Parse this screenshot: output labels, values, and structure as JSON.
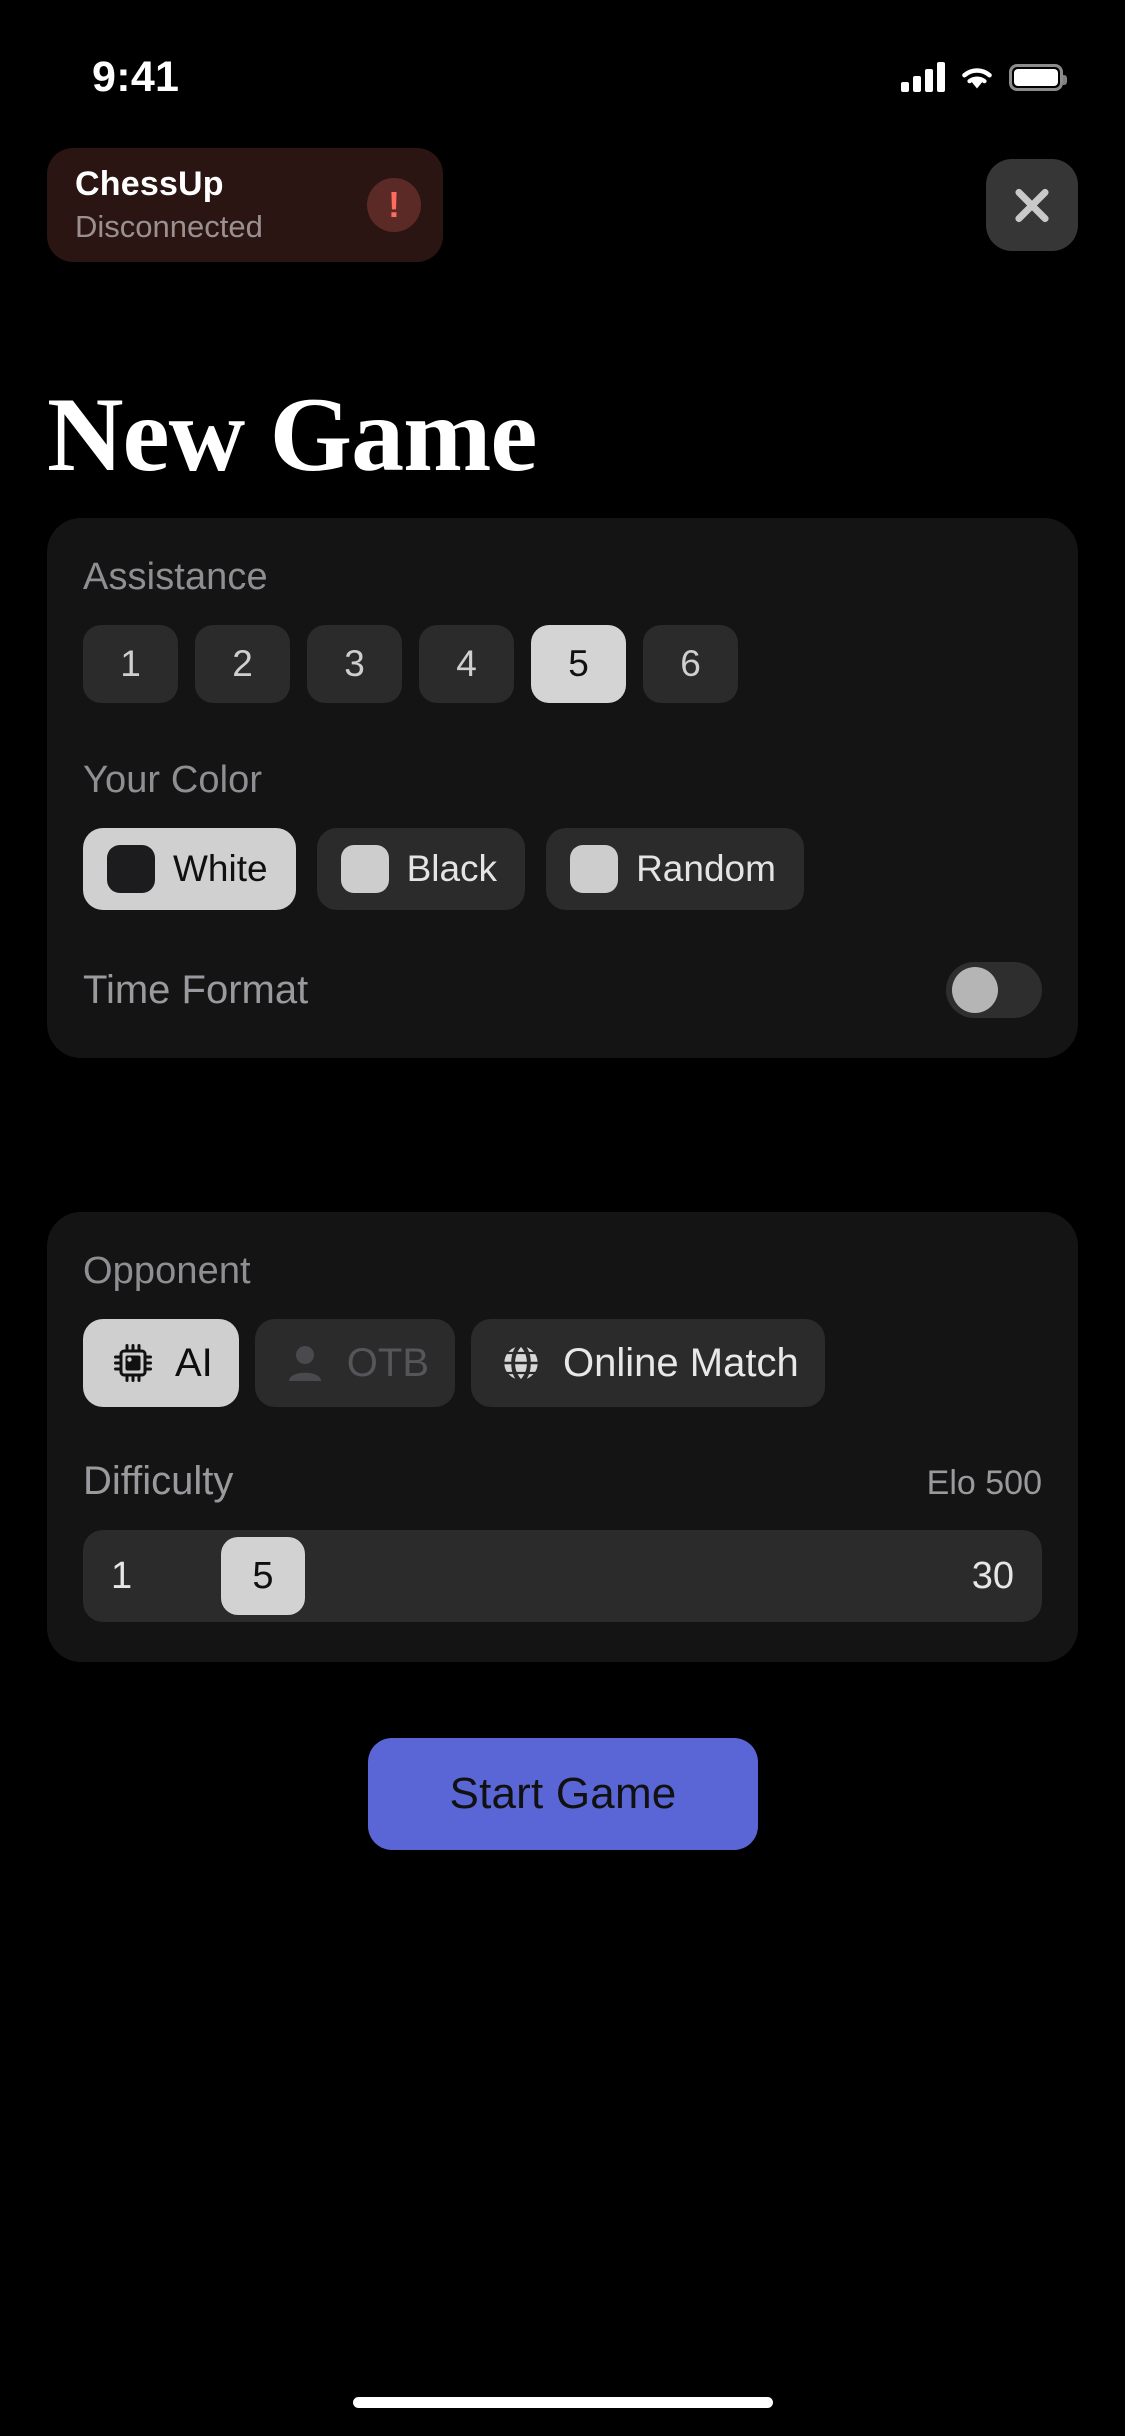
{
  "status_bar": {
    "time": "9:41",
    "signal_icon": "cellular-signal-icon",
    "wifi_icon": "wifi-icon",
    "battery_icon": "battery-icon"
  },
  "banner": {
    "device_name": "ChessUp",
    "connection_status": "Disconnected",
    "alert_icon": "alert-exclamation-icon",
    "alert_glyph": "!",
    "background_color": "#2a1513",
    "alert_color": "#ff6b5e"
  },
  "close_button": {
    "icon": "close-x-icon",
    "background_color": "#363636"
  },
  "page": {
    "title": "New Game"
  },
  "assistance": {
    "label": "Assistance",
    "options": [
      "1",
      "2",
      "3",
      "4",
      "5",
      "6"
    ],
    "selected": "5"
  },
  "your_color": {
    "label": "Your Color",
    "options": [
      {
        "label": "White",
        "swatch": "dark",
        "selected": true
      },
      {
        "label": "Black",
        "swatch": "light",
        "selected": false
      },
      {
        "label": "Random",
        "swatch": "light",
        "selected": false
      }
    ]
  },
  "time_format": {
    "label": "Time Format",
    "enabled": false,
    "toggle_icon": "toggle-switch-off"
  },
  "opponent": {
    "label": "Opponent",
    "options": [
      {
        "label": "AI",
        "icon": "cpu-chip-icon",
        "selected": true,
        "disabled": false
      },
      {
        "label": "OTB",
        "icon": "person-icon",
        "selected": false,
        "disabled": true
      },
      {
        "label": "Online Match",
        "icon": "globe-icon",
        "selected": false,
        "disabled": false
      }
    ]
  },
  "difficulty": {
    "label": "Difficulty",
    "elo_text": "Elo 500",
    "min": "1",
    "max": "30",
    "value": "5"
  },
  "primary_action": {
    "label": "Start Game",
    "color": "#5b66d6"
  }
}
